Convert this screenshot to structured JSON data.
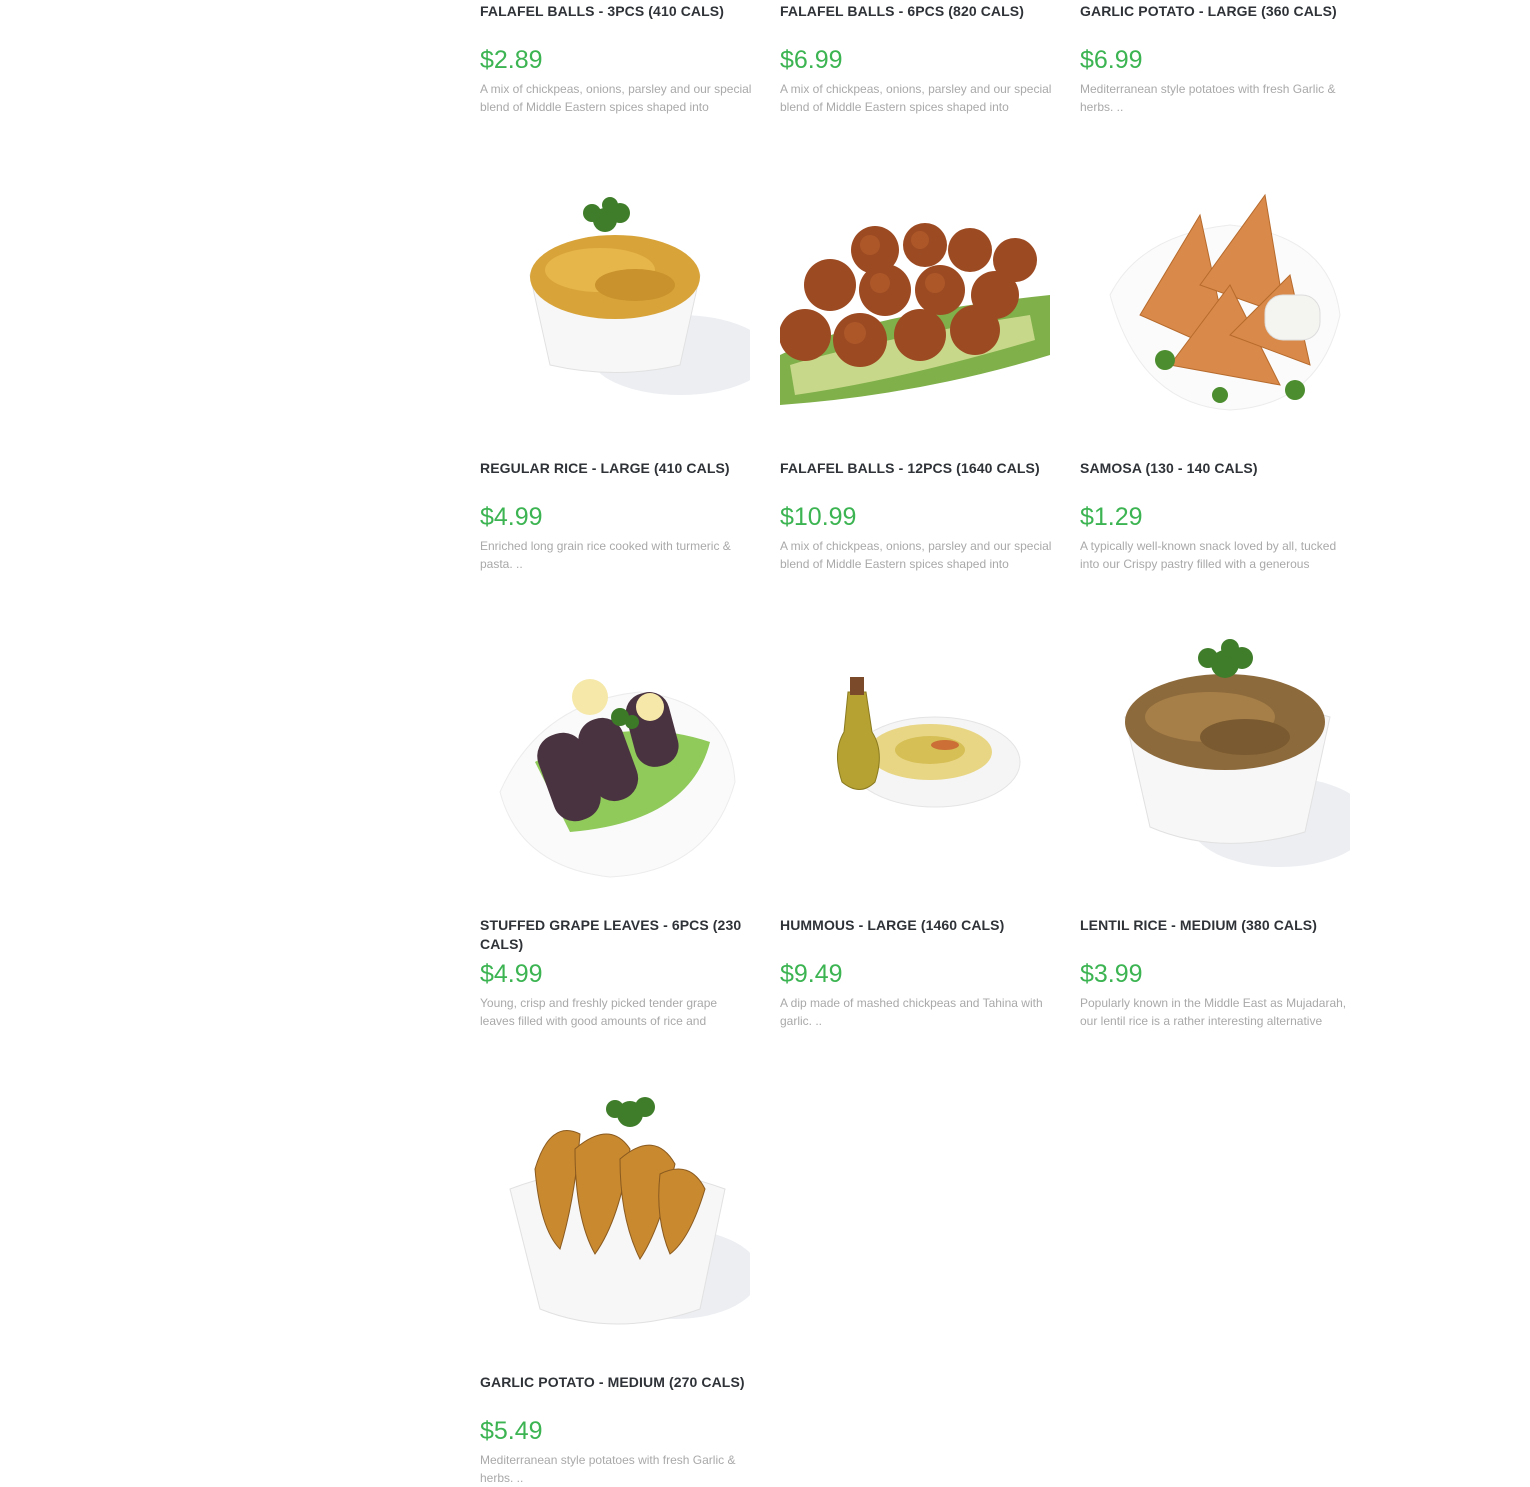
{
  "menu": {
    "items": [
      {
        "title": "FALAFEL BALLS - 3PCS (410 CALS)",
        "price": "$2.89",
        "description": "A mix of chickpeas, onions, parsley and our special blend of Middle Eastern spices shaped into",
        "image_icon": "no-image"
      },
      {
        "title": "FALAFEL BALLS - 6PCS (820 CALS)",
        "price": "$6.99",
        "description": "A mix of chickpeas, onions, parsley and our special blend of Middle Eastern spices shaped into",
        "image_icon": "no-image"
      },
      {
        "title": "GARLIC POTATO - LARGE (360 CALS)",
        "price": "$6.99",
        "description": "Mediterranean style potatoes with fresh Garlic & herbs. ..",
        "image_icon": "no-image"
      },
      {
        "title": "REGULAR RICE - LARGE (410 CALS)",
        "price": "$4.99",
        "description": "Enriched long grain rice cooked with turmeric & pasta. ..",
        "image_icon": "rice-bowl-photo"
      },
      {
        "title": "FALAFEL BALLS - 12PCS (1640 CALS)",
        "price": "$10.99",
        "description": "A mix of chickpeas, onions, parsley and our special blend of Middle Eastern spices shaped into",
        "image_icon": "falafel-photo"
      },
      {
        "title": "SAMOSA (130 - 140 CALS)",
        "price": "$1.29",
        "description": "A typically well-known snack loved by all, tucked into our Crispy pastry filled with a generous",
        "image_icon": "samosa-photo"
      },
      {
        "title": "STUFFED GRAPE LEAVES - 6PCS (230 CALS)",
        "price": "$4.99",
        "description": "Young, crisp and freshly picked tender grape leaves filled with good amounts of rice and",
        "image_icon": "grape-leaves-photo"
      },
      {
        "title": "HUMMOUS - LARGE (1460 CALS)",
        "price": "$9.49",
        "description": "A dip made of mashed chickpeas and Tahina with garlic.  ..",
        "image_icon": "hummous-photo"
      },
      {
        "title": "LENTIL RICE - MEDIUM (380 CALS)",
        "price": "$3.99",
        "description": "Popularly known in the Middle East as Mujadarah, our lentil rice is a rather interesting alternative",
        "image_icon": "lentil-rice-photo"
      },
      {
        "title": "GARLIC POTATO - MEDIUM (270 CALS)",
        "price": "$5.49",
        "description": "Mediterranean style potatoes with fresh Garlic & herbs. ..",
        "image_icon": "garlic-potato-photo"
      }
    ]
  },
  "colors": {
    "price": "#3cb452",
    "title": "#2f3338",
    "description": "#a9a9a9"
  }
}
